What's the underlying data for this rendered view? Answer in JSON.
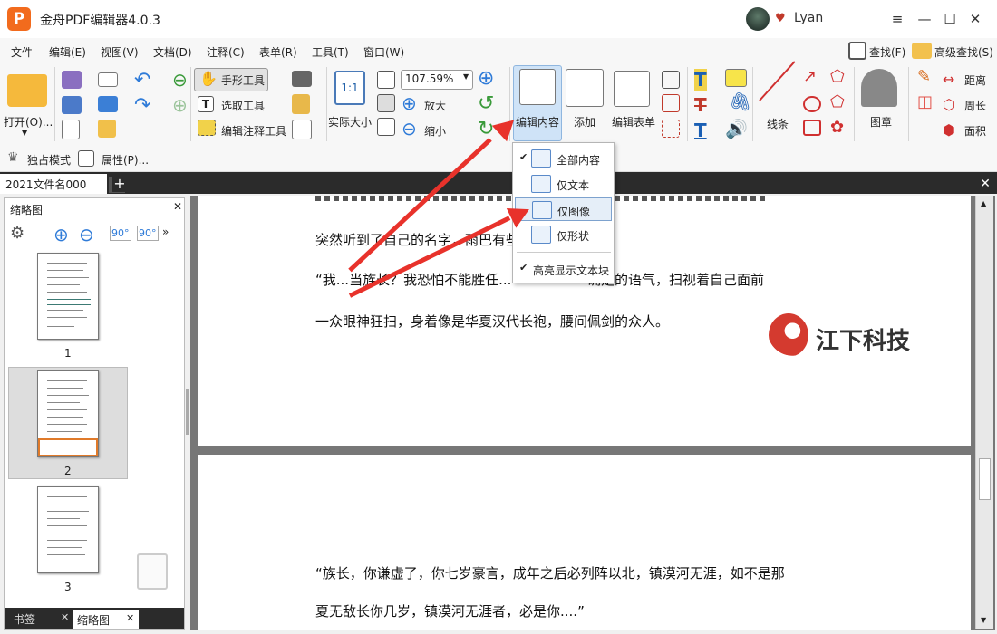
{
  "app": {
    "title": "金舟PDF编辑器4.0.3",
    "logo": "P",
    "user": "Lyan"
  },
  "menu": [
    "文件",
    "编辑(E)",
    "视图(V)",
    "文档(D)",
    "注释(C)",
    "表单(R)",
    "工具(T)",
    "窗口(W)"
  ],
  "menu_right": {
    "find": "查找(F)",
    "advanced_find": "高级查找(S)"
  },
  "ribbon": {
    "open": "打开(O)...",
    "hand_tool": "手形工具",
    "select_tool": "选取工具",
    "edit_annot_tool": "编辑注释工具",
    "actual_size": "实际大小",
    "zoom_value": "107.59%",
    "zoom_in": "放大",
    "zoom_out": "缩小",
    "edit_content": "编辑内容",
    "add": "添加",
    "edit_form": "编辑表单",
    "line": "线条",
    "stamp": "图章",
    "distance": "距离",
    "perimeter": "周长",
    "area": "面积"
  },
  "toolbar2": {
    "exclusive_mode": "独占模式",
    "properties": "属性(P)..."
  },
  "tab": {
    "doc_name": "2021文件名000"
  },
  "thumbnails": {
    "title": "缩略图",
    "pages": [
      "1",
      "2",
      "3"
    ],
    "bottom_tabs": [
      "书签",
      "缩略图"
    ]
  },
  "dropdown": {
    "items": [
      "全部内容",
      "仅文本",
      "仅图像",
      "仅形状"
    ],
    "highlight": "高亮显示文本块"
  },
  "document": {
    "lines": [
      "突然听到了自己的名字，雨巴有些",
      "“我...当族长？我恐怕不能胜任...",
      "确定的语气，扫视着自己面前",
      "一众眼神狂扫，身着像是华夏汉代长袍，腰间佩剑的众人。",
      "“族长，你谦虚了，你七岁豪言，成年之后必列阵以北，镇漠河无涯，如不是那",
      "夏无敌长你几岁，镇漠河无涯者，必是你....”"
    ],
    "watermark": "江下科技"
  },
  "colors": {
    "accent": "#e8322b",
    "logo": "#f26b1d",
    "tabbar": "#2b2b2b"
  }
}
